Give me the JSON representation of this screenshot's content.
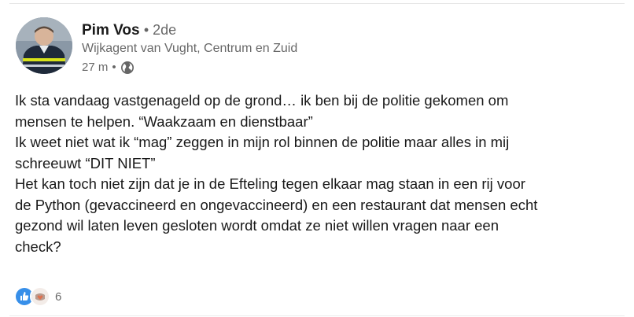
{
  "post": {
    "author": {
      "name": "Pim Vos",
      "degree": "• 2de",
      "headline": "Wijkagent van Vught, Centrum en Zuid"
    },
    "meta": {
      "time": "27 m",
      "separator": "•",
      "visibility_icon": "globe-icon"
    },
    "body_lines": [
      "Ik sta vandaag vastgenageld op de grond… ik ben bij de politie gekomen om",
      "mensen te helpen. “Waakzaam en dienstbaar”",
      "Ik weet niet wat ik “mag” zeggen in mijn rol binnen de politie maar alles in mij",
      "schreeuwt “DIT NIET”",
      "Het kan toch niet zijn dat je in de Efteling tegen elkaar mag staan in een rij voor",
      "de Python (gevaccineerd en ongevaccineerd) en een restaurant dat mensen echt",
      "gezond wil laten leven gesloten wordt omdat ze niet willen vragen naar een",
      "check?"
    ],
    "reactions": {
      "icons": [
        "like-icon",
        "love-icon"
      ],
      "count": "6"
    }
  }
}
